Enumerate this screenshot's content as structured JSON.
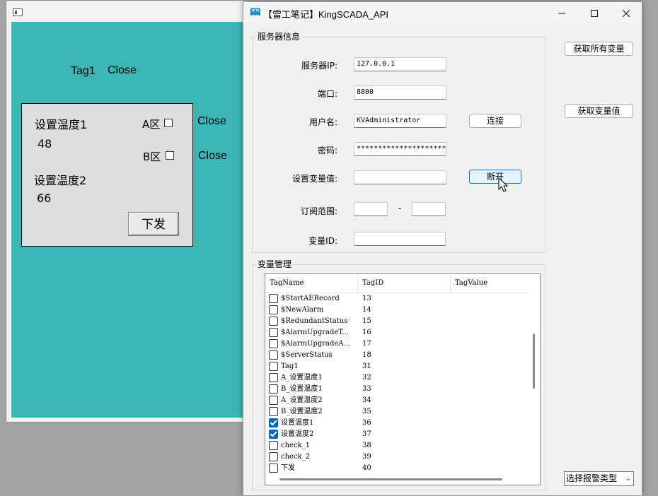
{
  "scada": {
    "tag1_label": "Tag1",
    "tag1_close": "Close",
    "a_close": "Close",
    "b_close": "Close",
    "set_temp1_label": "设置温度1",
    "set_temp1_value": "48",
    "set_temp2_label": "设置温度2",
    "set_temp2_value": "66",
    "zone_a_label": "A区",
    "zone_b_label": "B区",
    "send_button": "下发"
  },
  "dialog": {
    "title": "【雷工笔记】KingSCADA_API",
    "server_group_title": "服务器信息",
    "fields": {
      "ip_label": "服务器IP:",
      "ip_value": "127.0.0.1",
      "port_label": "端口:",
      "port_value": "8800",
      "user_label": "用户名:",
      "user_value": "KVAdministrator",
      "password_label": "密码:",
      "password_value": "*********************",
      "set_var_label": "设置变量值:",
      "set_var_value": "",
      "range_label": "订阅范围:",
      "range_from": "",
      "range_sep": "-",
      "range_to": "",
      "varid_label": "变量ID:",
      "varid_value": ""
    },
    "buttons": {
      "connect": "连接",
      "disconnect": "断开",
      "get_all_vars": "获取所有变量",
      "get_var_value": "获取变量值"
    },
    "var_group_title": "变量管理",
    "columns": [
      "TagName",
      "TagID",
      "TagValue"
    ],
    "rows": [
      {
        "name": "$StartAERecord",
        "id": "13",
        "checked": false
      },
      {
        "name": "$NewAlarm",
        "id": "14",
        "checked": false
      },
      {
        "name": "$RedundantStatus",
        "id": "15",
        "checked": false
      },
      {
        "name": "$AlarmUpgradeT...",
        "id": "16",
        "checked": false
      },
      {
        "name": "$AlarmUpgradeA...",
        "id": "17",
        "checked": false
      },
      {
        "name": "$ServerStatus",
        "id": "18",
        "checked": false
      },
      {
        "name": "Tag1",
        "id": "31",
        "checked": false
      },
      {
        "name": "A_设置温度1",
        "id": "32",
        "checked": false
      },
      {
        "name": "B_设置温度1",
        "id": "33",
        "checked": false
      },
      {
        "name": "A_设置温度2",
        "id": "34",
        "checked": false
      },
      {
        "name": "B_设置温度2",
        "id": "35",
        "checked": false
      },
      {
        "name": "设置温度1",
        "id": "36",
        "checked": true
      },
      {
        "name": "设置温度2",
        "id": "37",
        "checked": true
      },
      {
        "name": "check_1",
        "id": "38",
        "checked": false
      },
      {
        "name": "check_2",
        "id": "39",
        "checked": false
      },
      {
        "name": "下发",
        "id": "40",
        "checked": false
      }
    ],
    "alarm_type_select": "选择报警类型"
  },
  "colors": {
    "scada_canvas": "#3cb5b5",
    "checked": "#0067c0",
    "focus_border": "#0078d4"
  }
}
